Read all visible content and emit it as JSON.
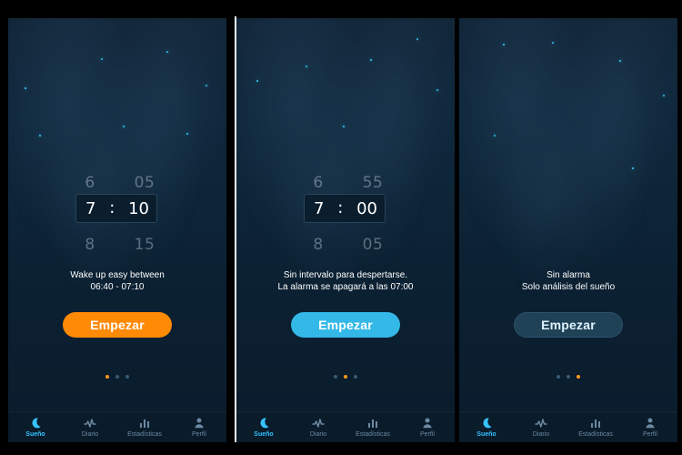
{
  "screens": [
    {
      "picker": {
        "top_hour": "6",
        "top_minute": "05",
        "hour": "7",
        "separator": ":",
        "minute": "10",
        "bottom_hour": "8",
        "bottom_minute": "15"
      },
      "message": {
        "line1": "Wake up easy between",
        "line2": "06:40 - 07:10"
      },
      "button": {
        "label": "Empezar",
        "color": "#ff8a06"
      },
      "pager": {
        "active_index": 0
      }
    },
    {
      "picker": {
        "top_hour": "6",
        "top_minute": "55",
        "hour": "7",
        "separator": ":",
        "minute": "00",
        "bottom_hour": "8",
        "bottom_minute": "05"
      },
      "message": {
        "line1": "Sin intervalo para despertarse.",
        "line2": "La alarma se apagará a las 07:00"
      },
      "button": {
        "label": "Empezar",
        "color": "#33b8e7"
      },
      "pager": {
        "active_index": 1
      }
    },
    {
      "message": {
        "line1": "Sin alarma",
        "line2": "Solo análisis del sueño"
      },
      "button": {
        "label": "Empezar",
        "color": "#204257"
      },
      "pager": {
        "active_index": 2
      }
    }
  ],
  "tabbar": {
    "items": [
      {
        "label": "Sueño",
        "icon": "moon-icon"
      },
      {
        "label": "Diario",
        "icon": "pulse-icon"
      },
      {
        "label": "Estadísticas",
        "icon": "bar-chart-icon"
      },
      {
        "label": "Perfil",
        "icon": "user-icon"
      }
    ],
    "active_index": 0,
    "accent_color": "#35c2ff",
    "inactive_color": "#6c8aa3"
  },
  "theme": {
    "background": "#0e2538",
    "star_color": "#39d2ff",
    "pager_active": "#ff9918",
    "pager_inactive": "#3a5a73"
  }
}
